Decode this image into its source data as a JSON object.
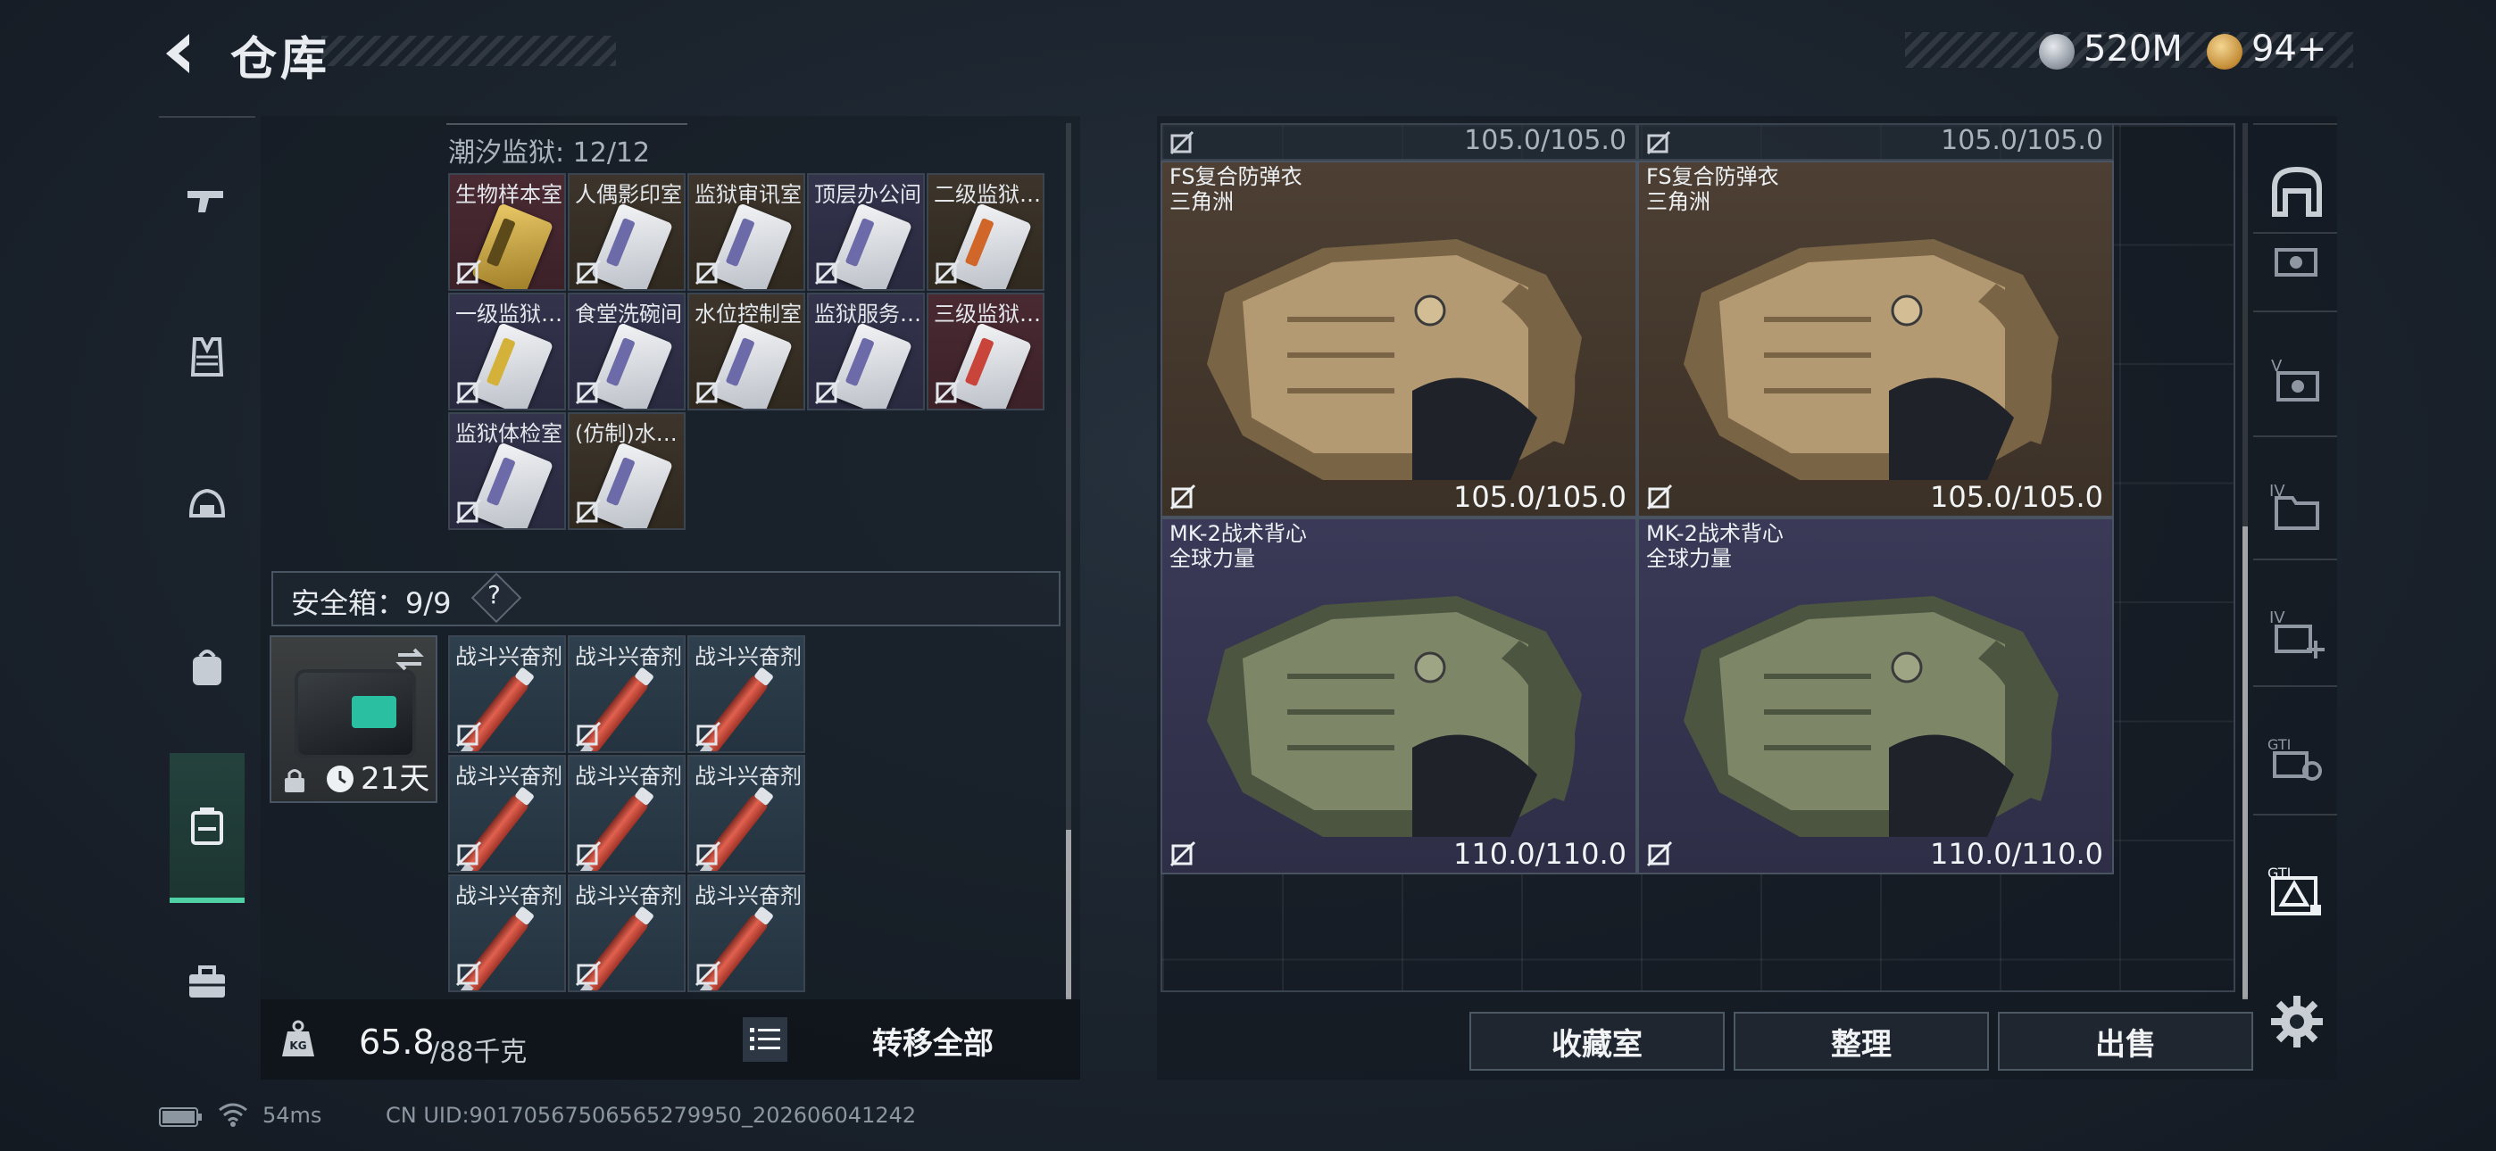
{
  "header": {
    "title": "仓库",
    "currencies": [
      {
        "icon": "silver-coin-icon",
        "value": "520M"
      },
      {
        "icon": "gold-coin-icon",
        "value": "94+"
      }
    ]
  },
  "left_nav": {
    "items": [
      {
        "icon": "pistol-icon"
      },
      {
        "icon": "armor-vest-icon"
      },
      {
        "icon": "helmet-icon"
      },
      {
        "icon": "backpack-icon"
      },
      {
        "icon": "safebox-icon",
        "active": true
      },
      {
        "icon": "toolbox-icon"
      }
    ]
  },
  "stash": {
    "prison_section": {
      "label": "潮汐监狱: 12/12",
      "cards": [
        {
          "name": "生物样本室",
          "bg": "red",
          "card": "gold"
        },
        {
          "name": "人偶影印室",
          "bg": "brown",
          "card": "white"
        },
        {
          "name": "监狱审讯室",
          "bg": "brown",
          "card": "white"
        },
        {
          "name": "顶层办公间",
          "bg": "navy",
          "card": "white"
        },
        {
          "name": "二级监狱…",
          "bg": "brown",
          "card": "orange"
        },
        {
          "name": "一级监狱…",
          "bg": "navy",
          "card": "yellow"
        },
        {
          "name": "食堂洗碗间",
          "bg": "navy",
          "card": "white"
        },
        {
          "name": "水位控制室",
          "bg": "brown",
          "card": "white"
        },
        {
          "name": "监狱服务…",
          "bg": "navy",
          "card": "white"
        },
        {
          "name": "三级监狱…",
          "bg": "red",
          "card": "red"
        },
        {
          "name": "监狱体检室",
          "bg": "navy",
          "card": "white"
        },
        {
          "name": "(仿制)水…",
          "bg": "brown",
          "card": "white"
        }
      ]
    },
    "safebox": {
      "label": "安全箱：9/9",
      "help": "?",
      "days": "21天",
      "items": [
        "战斗兴奋剂",
        "战斗兴奋剂",
        "战斗兴奋剂",
        "战斗兴奋剂",
        "战斗兴奋剂",
        "战斗兴奋剂",
        "战斗兴奋剂",
        "战斗兴奋剂",
        "战斗兴奋剂"
      ]
    },
    "weight": {
      "current": "65.8",
      "max": "/88千克"
    },
    "transfer_all": "转移全部"
  },
  "storage": {
    "top_strip": [
      "105.0/105.0",
      "105.0/105.0"
    ],
    "armors": [
      {
        "name": "FS复合防弹衣",
        "sub": "三角洲",
        "durability": "105.0/105.0",
        "bg": "brown"
      },
      {
        "name": "FS复合防弹衣",
        "sub": "三角洲",
        "durability": "105.0/105.0",
        "bg": "brown"
      },
      {
        "name": "MK-2战术背心",
        "sub": "全球力量",
        "durability": "110.0/110.0",
        "bg": "navy"
      },
      {
        "name": "MK-2战术背心",
        "sub": "全球力量",
        "durability": "110.0/110.0",
        "bg": "navy"
      }
    ],
    "actions": [
      "收藏室",
      "整理",
      "出售"
    ]
  },
  "right_nav": {
    "items": [
      {
        "icon": "home-base-icon"
      },
      {
        "icon": "storage-tab-icon"
      },
      {
        "icon": "storage-tab-v-icon"
      },
      {
        "icon": "storage-tab-iv-icon"
      },
      {
        "icon": "storage-tab-iv-plus-icon"
      },
      {
        "icon": "storage-tab-gti-icon"
      },
      {
        "icon": "storage-tab-gti-active-icon"
      },
      {
        "icon": "settings-gear-icon"
      }
    ]
  },
  "status": {
    "ping": "54ms",
    "uid": "CN UID:9017056750656527995​0_202606041242"
  },
  "colors": {
    "accent": "#4fd1a5",
    "panel": "#1b232d"
  }
}
